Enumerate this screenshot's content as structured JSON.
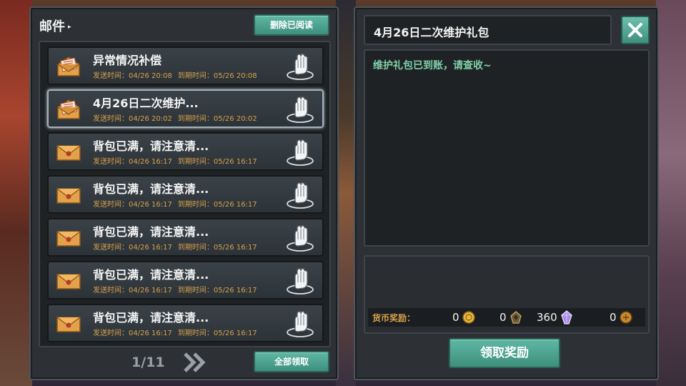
{
  "mail_panel": {
    "title": "邮件",
    "delete_read_label": "删除已阅读",
    "claim_all_label": "全部领取",
    "page_indicator": "1/11",
    "send_label": "发送时间：",
    "expire_label": "到期时间：",
    "items": [
      {
        "title": "异常情况补偿",
        "sent": "04/26 20:08",
        "expires": "05/26 20:08",
        "opened": true,
        "selected": false
      },
      {
        "title": "4月26日二次维护...",
        "sent": "04/26 20:02",
        "expires": "05/26 20:02",
        "opened": true,
        "selected": true
      },
      {
        "title": "背包已满，请注意清...",
        "sent": "04/26 16:17",
        "expires": "05/26 16:17",
        "opened": false,
        "selected": false
      },
      {
        "title": "背包已满，请注意清...",
        "sent": "04/26 16:17",
        "expires": "05/26 16:17",
        "opened": false,
        "selected": false
      },
      {
        "title": "背包已满，请注意清...",
        "sent": "04/26 16:17",
        "expires": "05/26 16:17",
        "opened": false,
        "selected": false
      },
      {
        "title": "背包已满，请注意清...",
        "sent": "04/26 16:17",
        "expires": "05/26 16:17",
        "opened": false,
        "selected": false
      },
      {
        "title": "背包已满，请注意清...",
        "sent": "04/26 16:17",
        "expires": "05/26 16:17",
        "opened": false,
        "selected": false
      }
    ]
  },
  "detail_panel": {
    "subject": "4月26日二次维护礼包",
    "body": "维护礼包已到账，请查收~",
    "currency_label": "货币奖励：",
    "currencies": [
      {
        "icon": "gold-coin-icon",
        "amount": "0"
      },
      {
        "icon": "dark-gem-icon",
        "amount": "0"
      },
      {
        "icon": "purple-crystal-icon",
        "amount": "360"
      },
      {
        "icon": "bronze-coin-icon",
        "amount": "0"
      }
    ],
    "collect_label": "领取奖励"
  },
  "colors": {
    "accent_teal": "#4fa692",
    "meta_orange": "#d8a04a",
    "body_green": "#7fd0a8"
  }
}
